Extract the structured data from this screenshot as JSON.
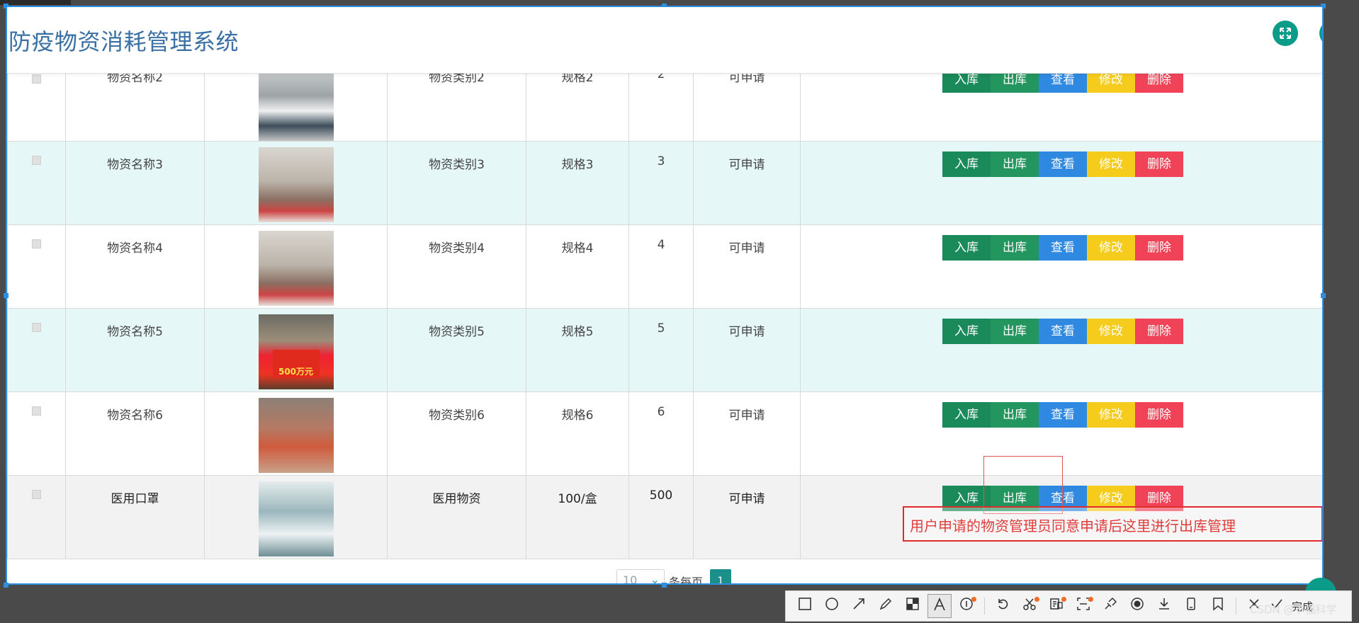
{
  "app": {
    "title": "防疫物资消耗管理系统"
  },
  "header_icons": {
    "fullscreen": "expand-arrows-icon",
    "user": "user-avatar-icon"
  },
  "rows": [
    {
      "name": "物资名称2",
      "category": "物资类别2",
      "spec": "规格2",
      "qty": "2",
      "status": "可申请",
      "image": "photo-handover"
    },
    {
      "name": "物资名称3",
      "category": "物资类别3",
      "spec": "规格3",
      "qty": "3",
      "status": "可申请",
      "image": "photo-volunteers"
    },
    {
      "name": "物资名称4",
      "category": "物资类别4",
      "spec": "规格4",
      "qty": "4",
      "status": "可申请",
      "image": "photo-volunteers"
    },
    {
      "name": "物资名称5",
      "category": "物资类别5",
      "spec": "规格5",
      "qty": "5",
      "status": "可申请",
      "image": "photo-donation-banner"
    },
    {
      "name": "物资名称6",
      "category": "物资类别6",
      "spec": "规格6",
      "qty": "6",
      "status": "可申请",
      "image": "photo-supplies"
    },
    {
      "name": "医用口罩",
      "category": "医用物资",
      "spec": "100/盒",
      "qty": "500",
      "status": "可申请",
      "image": "photo-medical-staff"
    }
  ],
  "banner_text": "500万元",
  "actions": {
    "stock_in": "入库",
    "stock_out": "出库",
    "view": "查看",
    "edit": "修改",
    "delete": "删除"
  },
  "colors": {
    "stock_in": "#1a8a5a",
    "stock_out": "#23955e",
    "view": "#2f89e0",
    "edit": "#f5cb1c",
    "delete": "#f04358",
    "title": "#3a70a4",
    "teal": "#0a9b89"
  },
  "annotation": {
    "text": "用户申请的物资管理员同意申请后这里进行出库管理"
  },
  "pagination": {
    "page_size": "10",
    "per_page_label": "条每页",
    "current_page": "1"
  },
  "toolbar": {
    "done_label": "完成",
    "watermark": "CSDN @不福科学"
  }
}
